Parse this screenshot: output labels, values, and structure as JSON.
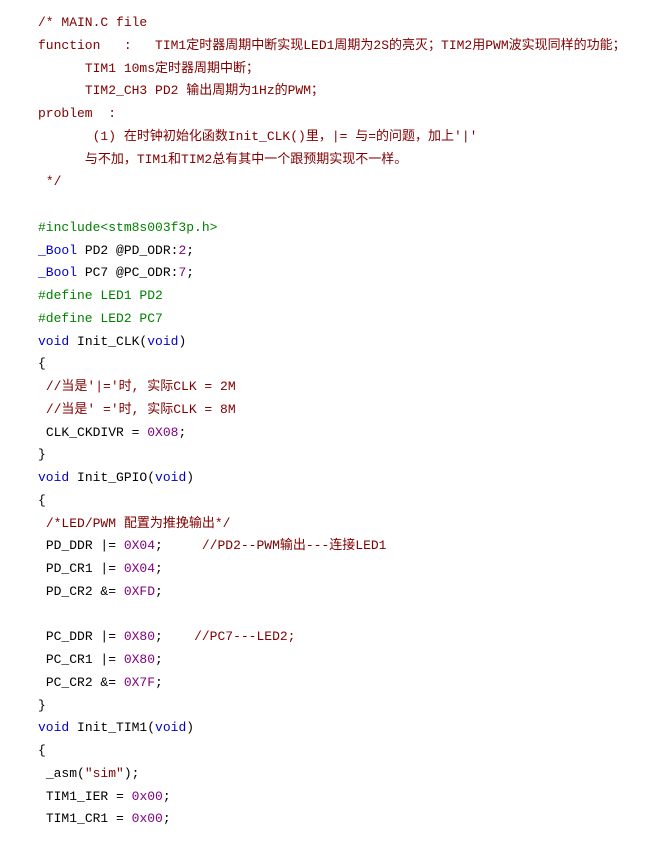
{
  "comment_block": {
    "l1": "/* MAIN.C file",
    "l2": "function   :   TIM1定时器周期中断实现LED1周期为2S的亮灭；TIM2用PWM波实现同样的功能；",
    "l3": "TIM1 10ms定时器周期中断；",
    "l4": "TIM2_CH3 PD2 输出周期为1Hz的PWM；",
    "l5": "problem  :",
    "l6": "(1) 在时钟初始化函数Init_CLK()里，|= 与=的问题，加上'|'",
    "l7": "与不加，TIM1和TIM2总有其中一个跟预期实现不一样。",
    "l8": " */"
  },
  "include": "#include<stm8s003f3p.h>",
  "bool1": {
    "kw": "_Bool",
    "rest": " PD2 @PD_ODR:",
    "num": "2",
    "semi": ";"
  },
  "bool2": {
    "kw": "_Bool",
    "rest": " PC7 @PC_ODR:",
    "num": "7",
    "semi": ";"
  },
  "def1": "#define LED1 PD2",
  "def2": "#define LED2 PC7",
  "fn_clk": {
    "void1": "void",
    "name": " Init_CLK(",
    "void2": "void",
    "close": ")"
  },
  "brace_open": "{",
  "brace_close": "}",
  "clk_c1": " //当是'|='时, 实际CLK = 2M",
  "clk_c2": " //当是' ='时, 实际CLK = 8M",
  "clk_stmt": {
    "a": " CLK_CKDIVR = ",
    "n": "0X08",
    "s": ";"
  },
  "fn_gpio": {
    "void1": "void",
    "name": " Init_GPIO(",
    "void2": "void",
    "close": ")"
  },
  "gpio_c1": " /*LED/PWM 配置为推挽输出*/",
  "gpio_l1": {
    "a": " PD_DDR |= ",
    "n": "0X04",
    "s": ";     ",
    "c": "//PD2--PWM输出---连接LED1"
  },
  "gpio_l2": {
    "a": " PD_CR1 |= ",
    "n": "0X04",
    "s": ";"
  },
  "gpio_l3": {
    "a": " PD_CR2 &= ",
    "n": "0XFD",
    "s": ";"
  },
  "gpio_l4": {
    "a": " PC_DDR |= ",
    "n": "0X80",
    "s": ";    ",
    "c": "//PC7---LED2;"
  },
  "gpio_l5": {
    "a": " PC_CR1 |= ",
    "n": "0X80",
    "s": ";"
  },
  "gpio_l6": {
    "a": " PC_CR2 &= ",
    "n": "0X7F",
    "s": ";"
  },
  "fn_tim1": {
    "void1": "void",
    "name": " Init_TIM1(",
    "void2": "void",
    "close": ")"
  },
  "tim1_l1": {
    "a": " _asm(",
    "str": "\"sim\"",
    "s": ");"
  },
  "tim1_l2": {
    "a": " TIM1_IER = ",
    "n": "0x00",
    "s": ";"
  },
  "tim1_l3": {
    "a": " TIM1_CR1 = ",
    "n": "0x00",
    "s": ";"
  }
}
